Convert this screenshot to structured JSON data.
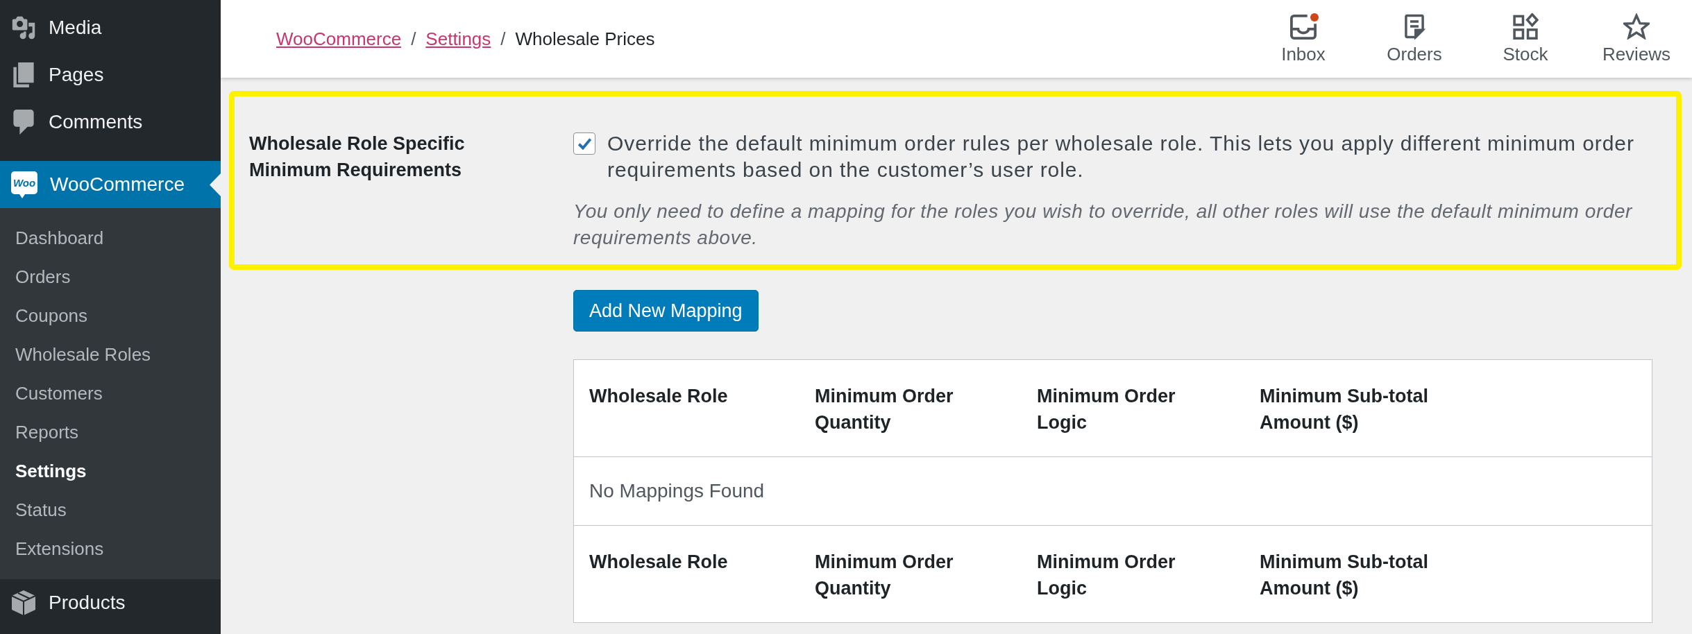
{
  "sidebar": {
    "items": [
      {
        "label": "Media",
        "selected": false
      },
      {
        "label": "Pages",
        "selected": false
      },
      {
        "label": "Comments",
        "selected": false
      },
      {
        "label": "WooCommerce",
        "logo": "Woo",
        "selected": true,
        "children": [
          {
            "label": "Dashboard",
            "selected": false
          },
          {
            "label": "Orders",
            "selected": false
          },
          {
            "label": "Coupons",
            "selected": false
          },
          {
            "label": "Wholesale Roles",
            "selected": false
          },
          {
            "label": "Customers",
            "selected": false
          },
          {
            "label": "Reports",
            "selected": false
          },
          {
            "label": "Settings",
            "selected": true
          },
          {
            "label": "Status",
            "selected": false
          },
          {
            "label": "Extensions",
            "selected": false
          }
        ]
      },
      {
        "label": "Products",
        "selected": false
      }
    ]
  },
  "header": {
    "breadcrumb": [
      {
        "label": "WooCommerce",
        "kind": "link"
      },
      {
        "label": "/",
        "kind": "separator"
      },
      {
        "label": "Settings",
        "kind": "link"
      },
      {
        "label": "/",
        "kind": "separator"
      },
      {
        "label": "Wholesale Prices",
        "kind": "current"
      }
    ],
    "activity": [
      {
        "label": "Inbox",
        "unread": true
      },
      {
        "label": "Orders",
        "unread": false
      },
      {
        "label": "Stock",
        "unread": false
      },
      {
        "label": "Reviews",
        "unread": false
      }
    ]
  },
  "setting": {
    "highlighted": true,
    "label": "Wholesale Role Specific Minimum Requirements",
    "checkbox": {
      "label": "Override the default minimum order rules per wholesale role. This lets you apply different minimum order requirements based on the customer’s user role.",
      "checked": true
    },
    "description": "You only need to define a mapping for the roles you wish to override, all other roles will use the default minimum order requirements above."
  },
  "add_button": "Add New Mapping",
  "table": {
    "columns": [
      "Wholesale Role",
      "Minimum Order Quantity",
      "Minimum Order Logic",
      "Minimum Sub-total Amount ($)"
    ],
    "empty_message": "No Mappings Found",
    "footer_columns": [
      "Wholesale Role",
      "Minimum Order Quantity",
      "Minimum Order Logic",
      "Minimum Sub-total Amount ($)"
    ]
  }
}
